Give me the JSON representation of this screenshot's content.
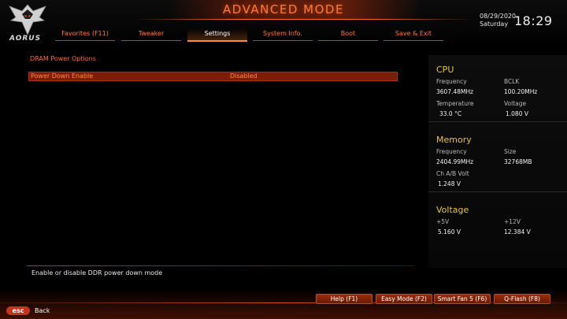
{
  "header": {
    "title": "ADVANCED MODE",
    "brand": "AORUS",
    "date": "08/29/2020",
    "day": "Saturday",
    "time": "18:29"
  },
  "tabs": [
    {
      "label": "Favorites (F11)",
      "active": false
    },
    {
      "label": "Tweaker",
      "active": false
    },
    {
      "label": "Settings",
      "active": true
    },
    {
      "label": "System Info.",
      "active": false
    },
    {
      "label": "Boot",
      "active": false
    },
    {
      "label": "Save & Exit",
      "active": false
    }
  ],
  "main": {
    "section_title": "DRAM Power Options",
    "options": [
      {
        "label": "Power Down Enable",
        "value": "Disabled",
        "selected": true
      }
    ],
    "help_text": "Enable or disable DDR power down mode"
  },
  "status": {
    "cpu": {
      "heading": "CPU",
      "frequency_label": "Frequency",
      "frequency": "3607.48MHz",
      "bclk_label": "BCLK",
      "bclk": "100.20MHz",
      "temperature_label": "Temperature",
      "temperature": "33.0 °C",
      "voltage_label": "Voltage",
      "voltage": "1.080 V"
    },
    "memory": {
      "heading": "Memory",
      "frequency_label": "Frequency",
      "frequency": "2404.99MHz",
      "size_label": "Size",
      "size": "32768MB",
      "chab_label": "Ch A/B Volt",
      "chab": "1.248 V"
    },
    "voltage": {
      "heading": "Voltage",
      "p5v_label": "+5V",
      "p5v": "5.160 V",
      "p12v_label": "+12V",
      "p12v": "12.384 V"
    }
  },
  "footer": {
    "buttons": [
      "Help (F1)",
      "Easy Mode (F2)",
      "Smart Fan 5 (F6)",
      "Q-Flash (F8)"
    ],
    "esc_key": "esc",
    "esc_label": "Back"
  },
  "colors": {
    "accent": "#ff6a2a",
    "heading": "#e8c24a",
    "selected_row": "#7a1e07"
  },
  "icons": {
    "logo": "aorus-falcon-icon"
  }
}
